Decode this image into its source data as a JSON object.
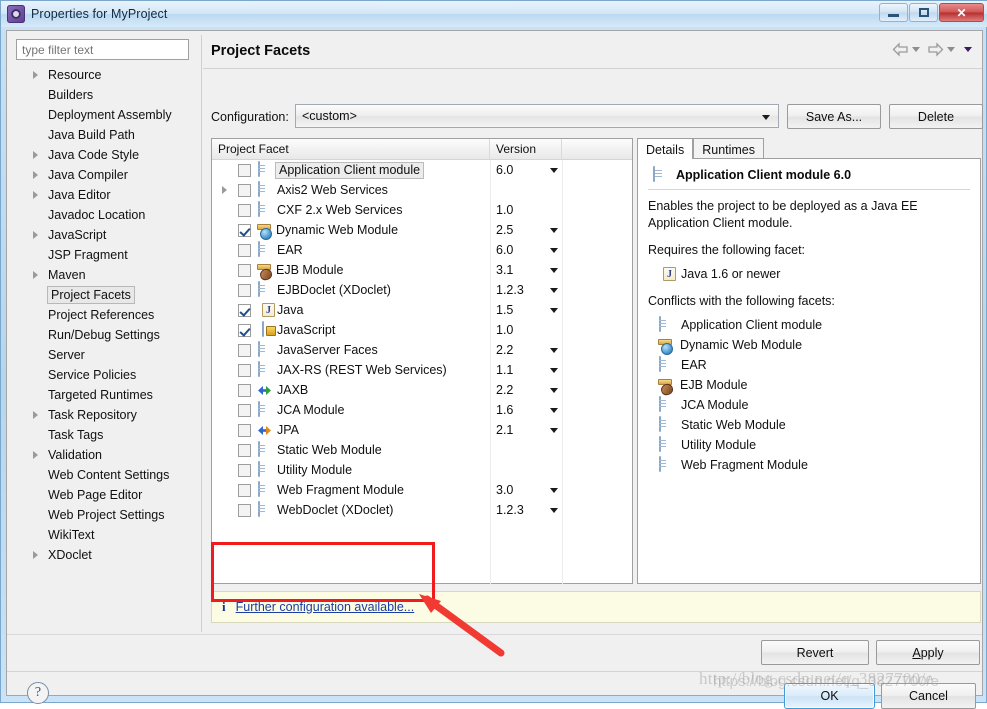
{
  "window": {
    "title": "Properties for MyProject",
    "app_icon": "eclipse-gear-icon",
    "minimize": "minimize-icon",
    "maximize": "maximize-icon",
    "close": "✕"
  },
  "sidebar": {
    "filter_placeholder": "type filter text",
    "filter_value": "",
    "items": [
      {
        "label": "Resource",
        "expandable": true,
        "selected": false
      },
      {
        "label": "Builders",
        "expandable": false,
        "selected": false
      },
      {
        "label": "Deployment Assembly",
        "expandable": false,
        "selected": false
      },
      {
        "label": "Java Build Path",
        "expandable": false,
        "selected": false
      },
      {
        "label": "Java Code Style",
        "expandable": true,
        "selected": false
      },
      {
        "label": "Java Compiler",
        "expandable": true,
        "selected": false
      },
      {
        "label": "Java Editor",
        "expandable": true,
        "selected": false
      },
      {
        "label": "Javadoc Location",
        "expandable": false,
        "selected": false
      },
      {
        "label": "JavaScript",
        "expandable": true,
        "selected": false
      },
      {
        "label": "JSP Fragment",
        "expandable": false,
        "selected": false
      },
      {
        "label": "Maven",
        "expandable": true,
        "selected": false
      },
      {
        "label": "Project Facets",
        "expandable": false,
        "selected": true
      },
      {
        "label": "Project References",
        "expandable": false,
        "selected": false
      },
      {
        "label": "Run/Debug Settings",
        "expandable": false,
        "selected": false
      },
      {
        "label": "Server",
        "expandable": false,
        "selected": false
      },
      {
        "label": "Service Policies",
        "expandable": false,
        "selected": false
      },
      {
        "label": "Targeted Runtimes",
        "expandable": false,
        "selected": false
      },
      {
        "label": "Task Repository",
        "expandable": true,
        "selected": false
      },
      {
        "label": "Task Tags",
        "expandable": false,
        "selected": false
      },
      {
        "label": "Validation",
        "expandable": true,
        "selected": false
      },
      {
        "label": "Web Content Settings",
        "expandable": false,
        "selected": false
      },
      {
        "label": "Web Page Editor",
        "expandable": false,
        "selected": false
      },
      {
        "label": "Web Project Settings",
        "expandable": false,
        "selected": false
      },
      {
        "label": "WikiText",
        "expandable": false,
        "selected": false
      },
      {
        "label": "XDoclet",
        "expandable": true,
        "selected": false
      }
    ]
  },
  "page": {
    "title": "Project Facets",
    "nav_back": "back-arrow-icon",
    "nav_forward": "forward-arrow-icon",
    "nav_menu": "dropdown-caret-icon"
  },
  "configuration": {
    "label": "Configuration:",
    "value": "<custom>",
    "save_as_label": "Save As...",
    "delete_label": "Delete"
  },
  "facet_table": {
    "columns": [
      "Project Facet",
      "Version",
      ""
    ],
    "rows": [
      {
        "name": "Application Client module",
        "version": "6.0",
        "checked": false,
        "has_caret": true,
        "expandable": false,
        "selected": true,
        "icon": "doc"
      },
      {
        "name": "Axis2 Web Services",
        "version": "",
        "checked": false,
        "has_caret": false,
        "expandable": true,
        "selected": false,
        "icon": "doc"
      },
      {
        "name": "CXF 2.x Web Services",
        "version": "1.0",
        "checked": false,
        "has_caret": false,
        "expandable": false,
        "selected": false,
        "icon": "doc"
      },
      {
        "name": "Dynamic Web Module",
        "version": "2.5",
        "checked": true,
        "has_caret": true,
        "expandable": false,
        "selected": false,
        "icon": "web"
      },
      {
        "name": "EAR",
        "version": "6.0",
        "checked": false,
        "has_caret": true,
        "expandable": false,
        "selected": false,
        "icon": "doc"
      },
      {
        "name": "EJB Module",
        "version": "3.1",
        "checked": false,
        "has_caret": true,
        "expandable": false,
        "selected": false,
        "icon": "ejb"
      },
      {
        "name": "EJBDoclet (XDoclet)",
        "version": "1.2.3",
        "checked": false,
        "has_caret": true,
        "expandable": false,
        "selected": false,
        "icon": "doc"
      },
      {
        "name": "Java",
        "version": "1.5",
        "checked": true,
        "has_caret": true,
        "expandable": false,
        "selected": false,
        "icon": "java"
      },
      {
        "name": "JavaScript",
        "version": "1.0",
        "checked": true,
        "has_caret": false,
        "expandable": false,
        "selected": false,
        "icon": "js"
      },
      {
        "name": "JavaServer Faces",
        "version": "2.2",
        "checked": false,
        "has_caret": true,
        "expandable": false,
        "selected": false,
        "icon": "doc"
      },
      {
        "name": "JAX-RS (REST Web Services)",
        "version": "1.1",
        "checked": false,
        "has_caret": true,
        "expandable": false,
        "selected": false,
        "icon": "doc"
      },
      {
        "name": "JAXB",
        "version": "2.2",
        "checked": false,
        "has_caret": true,
        "expandable": false,
        "selected": false,
        "icon": "arrows-green"
      },
      {
        "name": "JCA Module",
        "version": "1.6",
        "checked": false,
        "has_caret": true,
        "expandable": false,
        "selected": false,
        "icon": "doc"
      },
      {
        "name": "JPA",
        "version": "2.1",
        "checked": false,
        "has_caret": true,
        "expandable": false,
        "selected": false,
        "icon": "arrows-orange"
      },
      {
        "name": "Static Web Module",
        "version": "",
        "checked": false,
        "has_caret": false,
        "expandable": false,
        "selected": false,
        "icon": "doc"
      },
      {
        "name": "Utility Module",
        "version": "",
        "checked": false,
        "has_caret": false,
        "expandable": false,
        "selected": false,
        "icon": "doc"
      },
      {
        "name": "Web Fragment Module",
        "version": "3.0",
        "checked": false,
        "has_caret": true,
        "expandable": false,
        "selected": false,
        "icon": "doc"
      },
      {
        "name": "WebDoclet (XDoclet)",
        "version": "1.2.3",
        "checked": false,
        "has_caret": true,
        "expandable": false,
        "selected": false,
        "icon": "doc"
      }
    ]
  },
  "details": {
    "tabs": [
      {
        "label": "Details",
        "active": true
      },
      {
        "label": "Runtimes",
        "active": false
      }
    ],
    "heading": "Application Client module 6.0",
    "heading_icon": "doc",
    "description": "Enables the project to be deployed as a Java EE Application Client module.",
    "requires_label": "Requires the following facet:",
    "requires": [
      {
        "label": "Java 1.6 or newer",
        "icon": "java"
      }
    ],
    "conflicts_label": "Conflicts with the following facets:",
    "conflicts": [
      {
        "label": "Application Client module",
        "icon": "doc"
      },
      {
        "label": "Dynamic Web Module",
        "icon": "web"
      },
      {
        "label": "EAR",
        "icon": "doc"
      },
      {
        "label": "EJB Module",
        "icon": "ejb"
      },
      {
        "label": "JCA Module",
        "icon": "doc"
      },
      {
        "label": "Static Web Module",
        "icon": "doc"
      },
      {
        "label": "Utility Module",
        "icon": "doc"
      },
      {
        "label": "Web Fragment Module",
        "icon": "doc"
      }
    ]
  },
  "info_bar": {
    "icon": "information-icon",
    "icon_glyph": "i",
    "link_text": "Further configuration available..."
  },
  "footer": {
    "revert_label": "Revert",
    "apply_label": "Apply",
    "apply_mnemonic": "A",
    "help_icon": "help-question-icon",
    "help_glyph": "?",
    "ok_label": "OK",
    "cancel_label": "Cancel"
  },
  "annotation": {
    "highlight_color": "#ee1c1c",
    "arrow_color": "#f03a32"
  },
  "watermark": {
    "text": "http://blog.csdn.net/q_3827700/e",
    "text2": "https://blog.csdn.net/q_3827700/e"
  }
}
